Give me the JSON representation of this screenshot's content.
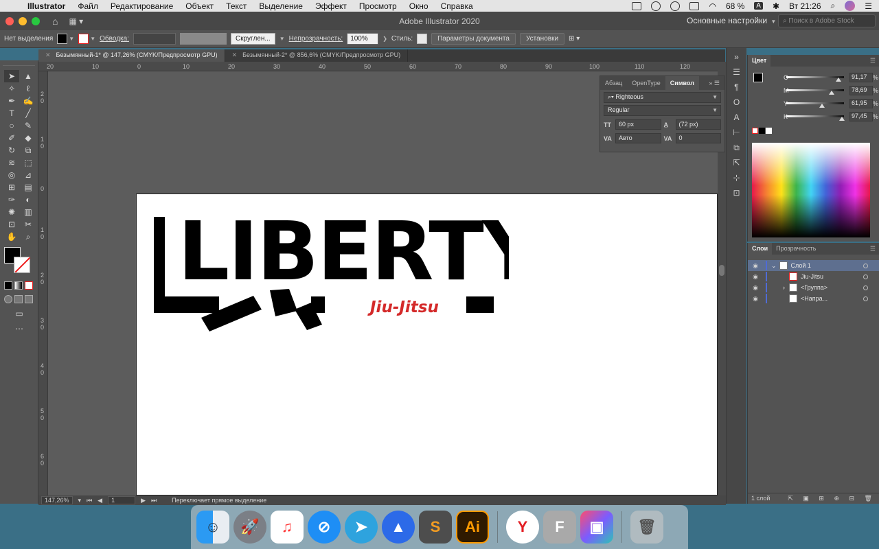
{
  "menubar": {
    "apple": "",
    "app_name": "Illustrator",
    "items": [
      "Файл",
      "Редактирование",
      "Объект",
      "Текст",
      "Выделение",
      "Эффект",
      "Просмотр",
      "Окно",
      "Справка"
    ],
    "battery": "68 %",
    "keyboard": "A",
    "clock": "Вт 21:26"
  },
  "titlebar": {
    "title": "Adobe Illustrator 2020",
    "workspace": "Основные настройки",
    "search_placeholder": "Поиск в Adobe Stock"
  },
  "controlbar": {
    "selection": "Нет выделения",
    "stroke_label": "Обводка:",
    "brush": "Скруглен...",
    "opacity_label": "Непрозрачность:",
    "opacity_value": "100%",
    "style_label": "Стиль:",
    "doc_params": "Параметры документа",
    "settings": "Установки"
  },
  "tabs": [
    {
      "label": "Безымянный-1* @ 147,26% (CMYK/Предпросмотр GPU)",
      "active": true
    },
    {
      "label": "Безымянный-2* @ 856,6% (CMYK/Предпросмотр GPU)",
      "active": false
    }
  ],
  "ruler": {
    "top": [
      "20",
      "10",
      "0",
      "10",
      "20",
      "30",
      "40",
      "50",
      "60",
      "70",
      "80",
      "90",
      "100",
      "110",
      "120"
    ],
    "left": [
      "2\n0",
      "1\n0",
      "0",
      "1\n0",
      "2\n0",
      "3\n0",
      "4\n0",
      "5\n0",
      "6\n0"
    ]
  },
  "character_panel": {
    "tabs": [
      "Абзац",
      "OpenType",
      "Символ"
    ],
    "font_family": "Righteous",
    "font_style": "Regular",
    "font_size": "60 px",
    "leading": "(72 px)",
    "kerning": "Авто",
    "tracking": "0"
  },
  "logo": {
    "word": "LIBERTY",
    "tagline": "Jiu-Jitsu",
    "tagline_color": "#d42a2a"
  },
  "color_panel": {
    "title": "Цвет",
    "channels": [
      {
        "label": "C",
        "value": "91,17",
        "unit": "%"
      },
      {
        "label": "M",
        "value": "78,69",
        "unit": "%"
      },
      {
        "label": "Y",
        "value": "61,95",
        "unit": "%"
      },
      {
        "label": "K",
        "value": "97,45",
        "unit": "%"
      }
    ]
  },
  "layers_panel": {
    "tabs": [
      "Слои",
      "Прозрачность"
    ],
    "rows": [
      {
        "name": "Слой 1",
        "top": true
      },
      {
        "name": "Jiu-Jitsu"
      },
      {
        "name": "<Группа>"
      },
      {
        "name": "<Напра..."
      }
    ],
    "footer": "1 слой"
  },
  "statusbar": {
    "zoom": "147,26%",
    "artboard": "1",
    "message": "Переключает прямое выделение"
  },
  "dock": {
    "items": [
      "finder-icon",
      "launchpad-icon",
      "music-icon",
      "safari-icon",
      "telegram-icon",
      "spark-icon",
      "sublime-icon",
      "illustrator-icon",
      "yandex-icon",
      "fontlab-icon",
      "affinity-icon",
      "trash-icon"
    ],
    "illustrator_label": "Ai",
    "fontlab_label": "F"
  }
}
